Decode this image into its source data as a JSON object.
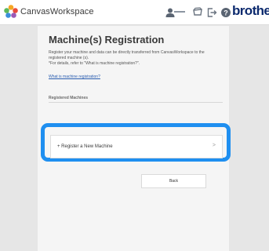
{
  "header": {
    "app_title": "CanvasWorkspace",
    "brand": "brother",
    "icons": [
      "app-logo-icon",
      "user-icon",
      "cart-icon",
      "logout-icon",
      "help-icon"
    ]
  },
  "main": {
    "title": "Machine(s) Registration",
    "description_line1": "Register your machine and data can be directly transferred from CanvasWorkspace to the",
    "description_line2": "registered machine (s).",
    "description_line3": "*For details, refer to \"What is machine registration?\".",
    "help_link": "What is machine registration?",
    "section_label": "Registered Machines",
    "register_item": "+ Register a New Machine",
    "register_chevron": ">",
    "back_button": "Back"
  },
  "colors": {
    "highlight": "#1f8ff0",
    "brand": "#0c2a6e",
    "link": "#2a5db0"
  }
}
